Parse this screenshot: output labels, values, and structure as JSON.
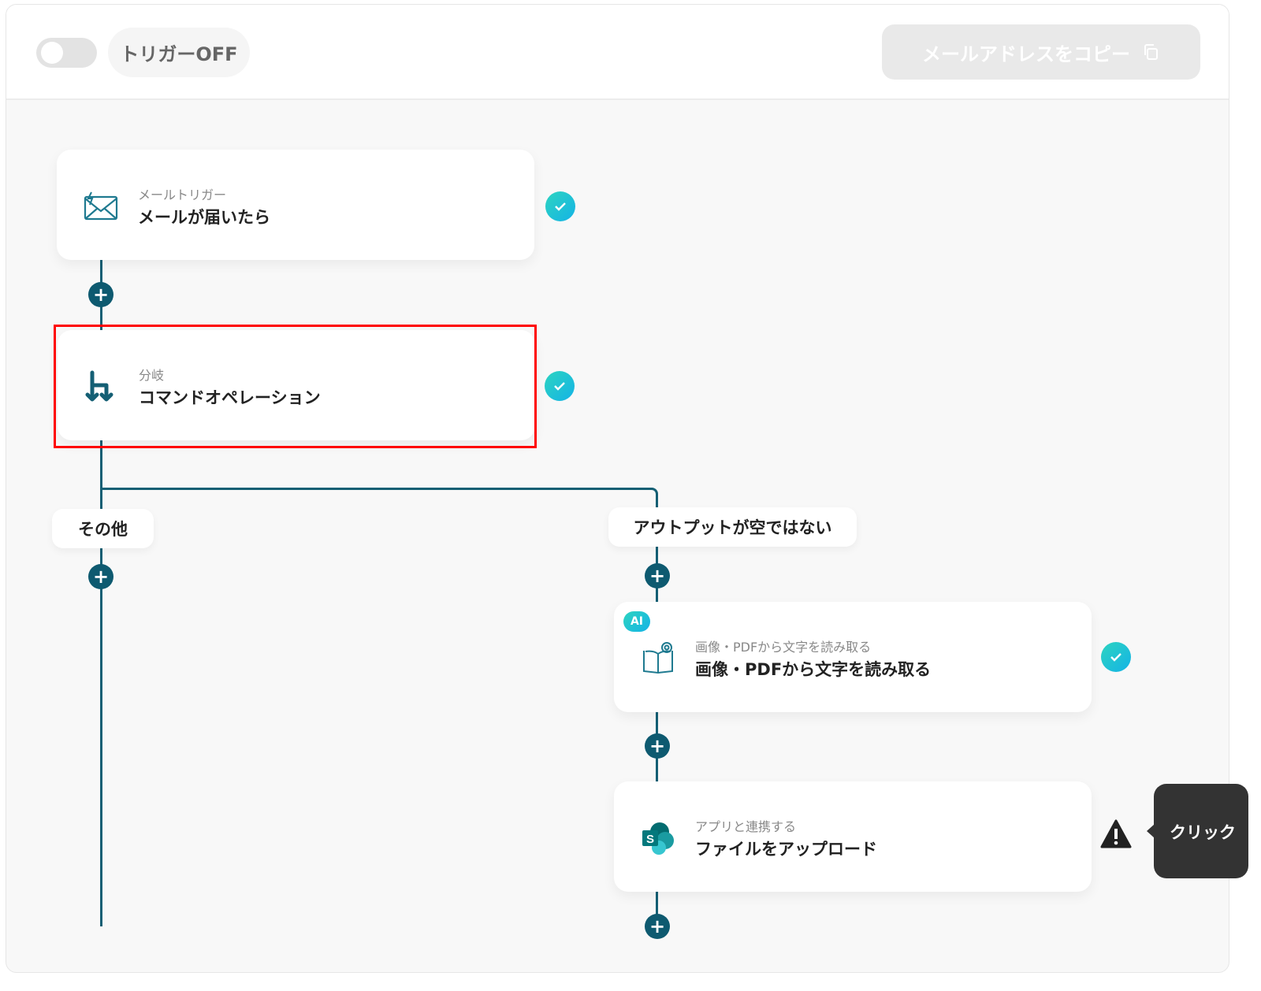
{
  "header": {
    "trigger_toggle_on": false,
    "trigger_label": "トリガーOFF",
    "copy_email_label": "メールアドレスをコピー"
  },
  "flow": {
    "steps": [
      {
        "subtitle": "メールトリガー",
        "title": "メールが届いたら",
        "icon": "mail-trigger-icon",
        "status": "complete"
      },
      {
        "subtitle": "分岐",
        "title": "コマンドオペレーション",
        "icon": "branch-icon",
        "status": "complete",
        "highlighted": true
      }
    ],
    "branches": [
      {
        "label": "その他"
      },
      {
        "label": "アウトプットが空ではない",
        "steps": [
          {
            "badge": "AI",
            "subtitle": "画像・PDFから文字を読み取る",
            "title": "画像・PDFから文字を読み取る",
            "icon": "ocr-book-icon",
            "status": "complete"
          },
          {
            "subtitle": "アプリと連携する",
            "title": "ファイルをアップロード",
            "icon": "sharepoint-icon",
            "status": "warning"
          }
        ]
      }
    ]
  },
  "tooltip": {
    "text": "クリック"
  },
  "colors": {
    "line": "#145f74",
    "plus": "#0e5a70",
    "check": "#1fc3d6",
    "highlight": "#ff0000",
    "tooltip": "#333333"
  }
}
